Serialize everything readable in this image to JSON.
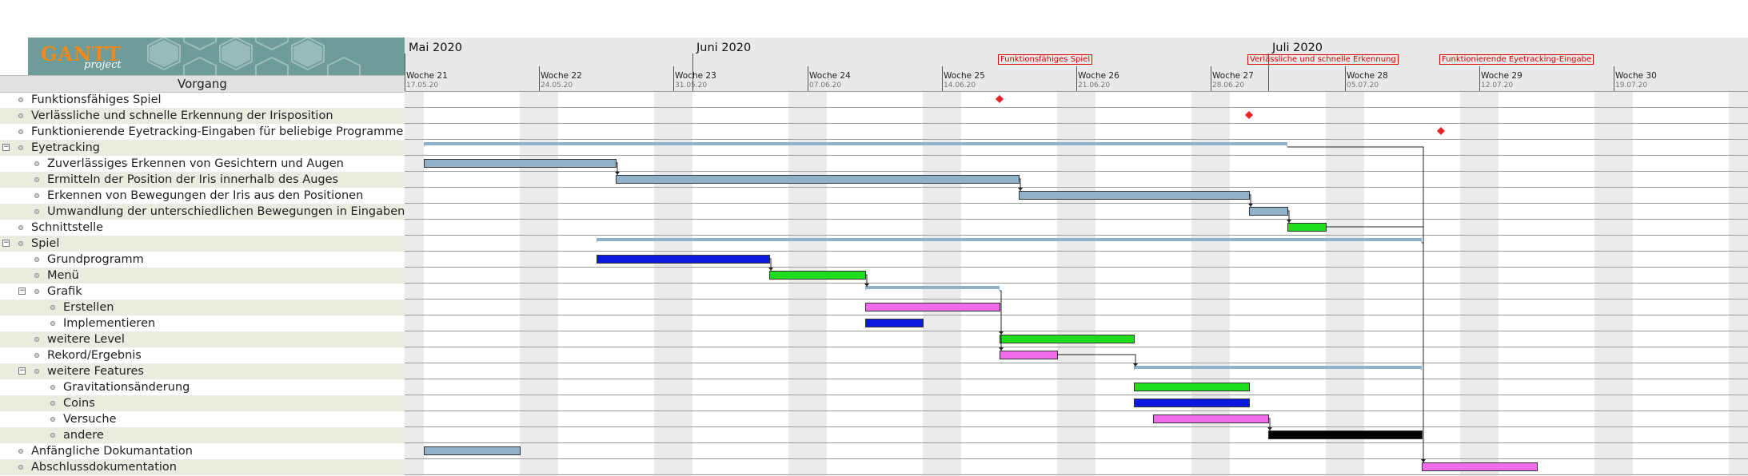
{
  "app": {
    "logo_text": "GANTT",
    "logo_subtext": "project"
  },
  "task_column": {
    "header": "Vorgang"
  },
  "timeline": {
    "months": [
      {
        "label": "Mai 2020",
        "day": 0
      },
      {
        "label": "Juni 2020",
        "day": 15
      },
      {
        "label": "Juli 2020",
        "day": 45
      }
    ],
    "weeks": [
      {
        "label": "Woche 21",
        "date": "17.05.20"
      },
      {
        "label": "Woche 22",
        "date": "24.05.20"
      },
      {
        "label": "Woche 23",
        "date": "31.05.20"
      },
      {
        "label": "Woche 24",
        "date": "07.06.20"
      },
      {
        "label": "Woche 25",
        "date": "14.06.20"
      },
      {
        "label": "Woche 26",
        "date": "21.06.20"
      },
      {
        "label": "Woche 27",
        "date": "28.06.20"
      },
      {
        "label": "Woche 28",
        "date": "05.07.20"
      },
      {
        "label": "Woche 29",
        "date": "12.07.20"
      },
      {
        "label": "Woche 30",
        "date": "19.07.20"
      }
    ],
    "milestone_tags": [
      {
        "label": "Funktionsfähiges Spiel",
        "day": 31
      },
      {
        "label": "Verlässliche und schnelle Erkennung",
        "day": 44
      },
      {
        "label": "Funktionierende Eyetracking-Eingabe",
        "day": 54
      }
    ]
  },
  "tasks": [
    {
      "name": "Funktionsfähiges Spiel",
      "level": 0,
      "group": false,
      "type": "milestone",
      "start": 31,
      "color": "#e8232a"
    },
    {
      "name": "Verlässliche und schnelle Erkennung der Irisposition",
      "level": 0,
      "group": false,
      "type": "milestone",
      "start": 44,
      "color": "#e8232a"
    },
    {
      "name": "Funktionierende Eyetracking-Eingaben für beliebige Programme",
      "level": 0,
      "group": false,
      "type": "milestone",
      "start": 54,
      "color": "#e8232a"
    },
    {
      "name": "Eyetracking",
      "level": 0,
      "group": true,
      "type": "summary",
      "start": 1,
      "end": 46,
      "color": "#8fb1c9"
    },
    {
      "name": "Zuverlässiges Erkennen von Gesichtern und Augen",
      "level": 1,
      "group": false,
      "type": "task",
      "start": 1,
      "end": 11,
      "color": "#8fb1c9"
    },
    {
      "name": "Ermitteln der Position der Iris innerhalb des Auges",
      "level": 1,
      "group": false,
      "type": "task",
      "start": 11,
      "end": 32,
      "color": "#8fb1c9"
    },
    {
      "name": "Erkennen von Bewegungen der Iris aus den Positionen",
      "level": 1,
      "group": false,
      "type": "task",
      "start": 32,
      "end": 44,
      "color": "#8fb1c9"
    },
    {
      "name": "Umwandlung der unterschiedlichen Bewegungen in Eingaben",
      "level": 1,
      "group": false,
      "type": "task",
      "start": 44,
      "end": 46,
      "color": "#8fb1c9"
    },
    {
      "name": "Schnittstelle",
      "level": 0,
      "group": false,
      "type": "task",
      "start": 46,
      "end": 48,
      "color": "#1edc1e"
    },
    {
      "name": "Spiel",
      "level": 0,
      "group": true,
      "type": "summary",
      "start": 10,
      "end": 53,
      "color": "#8fb1c9"
    },
    {
      "name": "Grundprogramm",
      "level": 1,
      "group": false,
      "type": "task",
      "start": 10,
      "end": 19,
      "color": "#0a18e0"
    },
    {
      "name": "Menü",
      "level": 1,
      "group": false,
      "type": "task",
      "start": 19,
      "end": 24,
      "color": "#1edc1e"
    },
    {
      "name": "Grafik",
      "level": 1,
      "group": true,
      "type": "summary",
      "start": 24,
      "end": 31,
      "color": "#8fb1c9"
    },
    {
      "name": "Erstellen",
      "level": 2,
      "group": false,
      "type": "task",
      "start": 24,
      "end": 31,
      "color": "#f06ce8"
    },
    {
      "name": "Implementieren",
      "level": 2,
      "group": false,
      "type": "task",
      "start": 24,
      "end": 27,
      "color": "#0a18e0"
    },
    {
      "name": "weitere Level",
      "level": 1,
      "group": false,
      "type": "task",
      "start": 31,
      "end": 38,
      "color": "#1edc1e"
    },
    {
      "name": "Rekord/Ergebnis",
      "level": 1,
      "group": false,
      "type": "task",
      "start": 31,
      "end": 34,
      "color": "#f06ce8"
    },
    {
      "name": "weitere Features",
      "level": 1,
      "group": true,
      "type": "summary",
      "start": 38,
      "end": 53,
      "color": "#8fb1c9"
    },
    {
      "name": "Gravitationsänderung",
      "level": 2,
      "group": false,
      "type": "task",
      "start": 38,
      "end": 44,
      "color": "#1edc1e"
    },
    {
      "name": "Coins",
      "level": 2,
      "group": false,
      "type": "task",
      "start": 38,
      "end": 44,
      "color": "#0a18e0"
    },
    {
      "name": "Versuche",
      "level": 2,
      "group": false,
      "type": "task",
      "start": 39,
      "end": 45,
      "color": "#f06ce8"
    },
    {
      "name": "andere",
      "level": 2,
      "group": false,
      "type": "task",
      "start": 45,
      "end": 53,
      "color": "#000000"
    },
    {
      "name": "Anfängliche Dokumantation",
      "level": 0,
      "group": false,
      "type": "task",
      "start": 1,
      "end": 6,
      "color": "#8fb1c9"
    },
    {
      "name": "Abschlussdokumentation",
      "level": 0,
      "group": false,
      "type": "task",
      "start": 53,
      "end": 59,
      "color": "#f06ce8"
    }
  ],
  "dependencies": [
    {
      "from": 4,
      "to": 5
    },
    {
      "from": 5,
      "to": 6
    },
    {
      "from": 6,
      "to": 7
    },
    {
      "from": 7,
      "to": 8
    },
    {
      "from": 10,
      "to": 11
    },
    {
      "from": 11,
      "to": 12
    },
    {
      "from": 12,
      "to": 15
    },
    {
      "from": 12,
      "to": 16
    },
    {
      "from": 16,
      "to": 17
    },
    {
      "from": 20,
      "to": 21
    },
    {
      "from": 3,
      "to": 23
    },
    {
      "from": 8,
      "to": 23
    },
    {
      "from": 9,
      "to": 23
    }
  ]
}
